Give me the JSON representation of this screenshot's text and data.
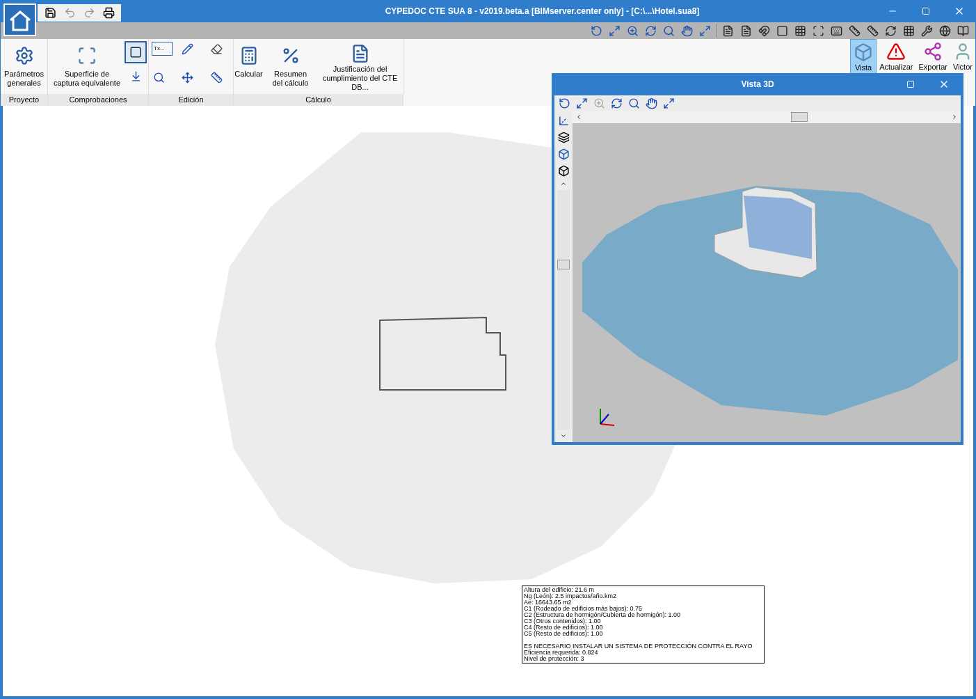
{
  "window": {
    "title": "CYPEDOC CTE SUA 8 - v2019.beta.a [BIMserver.center only] - [C:\\...\\Hotel.sua8]"
  },
  "ribbon": {
    "groups": [
      {
        "label": "Proyecto",
        "buttons": [
          {
            "kind": "large",
            "label": "Parámetros generales"
          }
        ]
      },
      {
        "label": "Comprobaciones",
        "buttons": [
          {
            "kind": "large",
            "label": "Superficie de captura equivalente"
          },
          {
            "kind": "toggle",
            "selected": true
          }
        ]
      },
      {
        "label": "Edición",
        "buttons": [
          {
            "kind": "text-tool",
            "label": "Tx..."
          }
        ]
      },
      {
        "label": "Cálculo",
        "buttons": [
          {
            "kind": "large",
            "label": "Calcular"
          },
          {
            "kind": "large",
            "label": "Resumen del cálculo"
          },
          {
            "kind": "large",
            "label": "Justificación del cumplimiento del CTE DB..."
          }
        ]
      }
    ],
    "right_buttons": [
      {
        "label": "Vista",
        "selected": true
      },
      {
        "label": "Actualizar",
        "selected": false
      },
      {
        "label": "Exportar",
        "selected": false
      },
      {
        "label": "Victor",
        "selected": false
      }
    ]
  },
  "view_3d": {
    "title": "Vista 3D"
  },
  "results": {
    "blocks": [
      [
        "Altura del edificio: 21.6 m",
        "Ng (León): 2.5 impactos/año.km2",
        "Ae: 16643.65 m2",
        "C1 (Rodeado de edificios más bajos): 0.75",
        "C2 (Estructura de hormigón/Cubierta de hormigón): 1.00",
        "C3 (Otros contenidos): 1.00",
        "C4 (Resto de edificios): 1.00",
        "C5 (Resto de edificios): 1.00"
      ],
      [
        "ES NECESARIO INSTALAR UN SISTEMA DE PROTECCIÓN CONTRA EL RAYO",
        "Eficiencia requerida: 0.824",
        "Nivel de protección: 3"
      ]
    ]
  }
}
